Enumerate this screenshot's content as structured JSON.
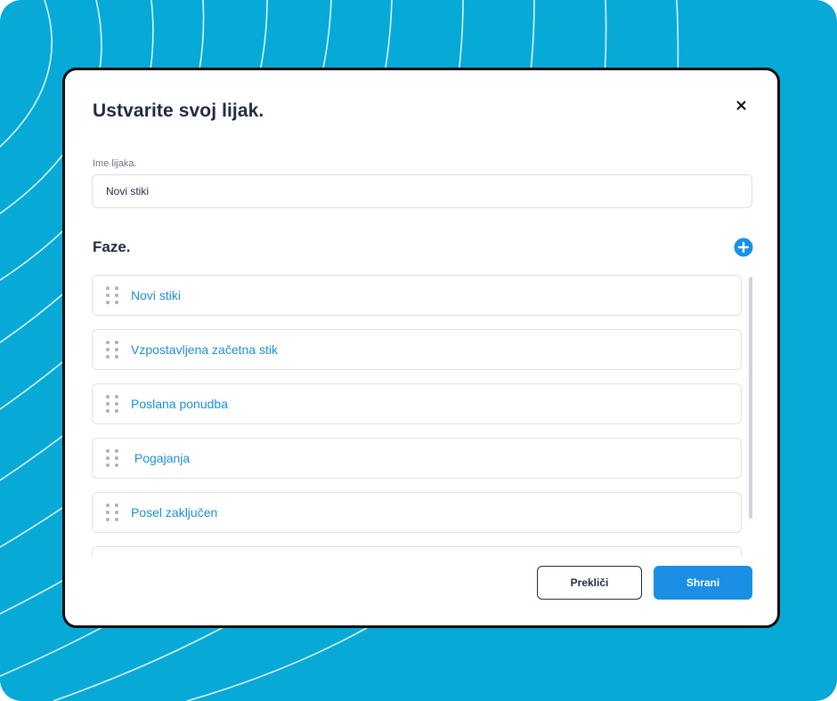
{
  "colors": {
    "background": "#07a9d6",
    "accent": "#1a8fe3",
    "phase_text": "#1a8fd8",
    "title_text": "#1f2a44"
  },
  "modal": {
    "title": "Ustvarite svoj lijak.",
    "close_icon": "close-icon"
  },
  "funnel_name": {
    "label": "Ime lijaka.",
    "value": "Novi stiki"
  },
  "phases": {
    "title": "Faze.",
    "add_icon": "plus-circle-icon",
    "drag_icon": "drag-handle-icon",
    "items": [
      {
        "label": "Novi stiki"
      },
      {
        "label": "Vzpostavljena začetna stik"
      },
      {
        "label": "Poslana ponudba"
      },
      {
        "label": " Pogajanja"
      },
      {
        "label": "Posel zaključen"
      },
      {
        "label": ""
      }
    ]
  },
  "actions": {
    "cancel_label": "Prekliči",
    "save_label": "Shrani"
  }
}
